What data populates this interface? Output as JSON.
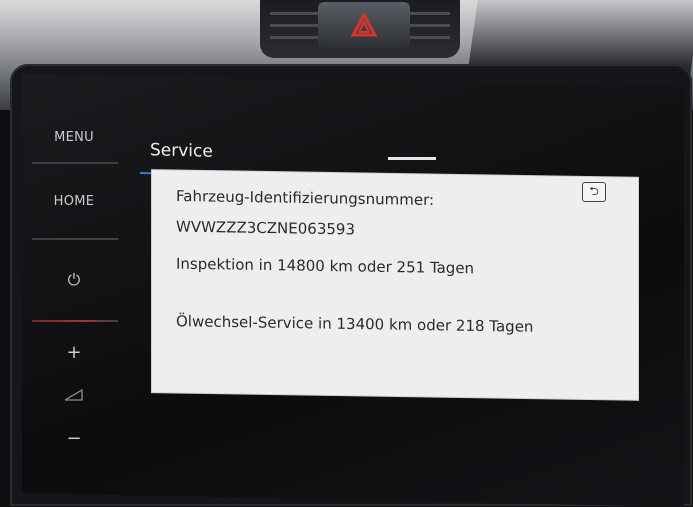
{
  "side_nav": {
    "menu_label": "MENU",
    "home_label": "HOME",
    "power_icon": "power-icon",
    "volume_up_icon": "plus-icon",
    "volume_icon": "volume-wedge-icon",
    "volume_down_icon": "minus-icon"
  },
  "screen": {
    "title": "Service",
    "back_icon": "back-arrow-icon",
    "vin_label": "Fahrzeug-Identifizierungsnummer:",
    "vin_value": "WVWZZZ3CZNE063593",
    "inspection_text": "Inspektion in 14800 km oder 251 Tagen",
    "oil_service_text": "Ölwechsel-Service in 13400 km oder 218 Tagen"
  },
  "colors": {
    "accent_blue": "#2f7fe0",
    "hazard_red": "#d8342b"
  }
}
